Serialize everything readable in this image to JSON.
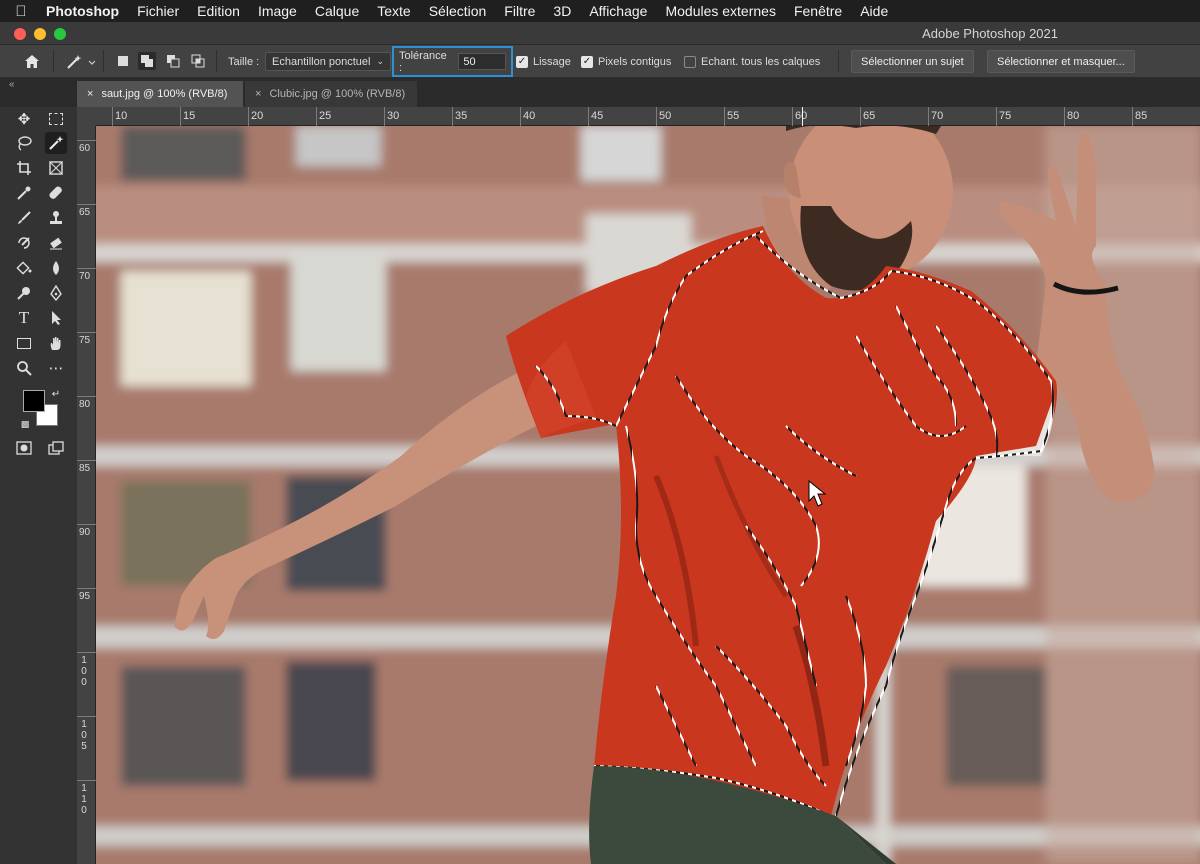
{
  "menubar": {
    "app_name": "Photoshop",
    "items": [
      "Fichier",
      "Edition",
      "Image",
      "Calque",
      "Texte",
      "Sélection",
      "Filtre",
      "3D",
      "Affichage",
      "Modules externes",
      "Fenêtre",
      "Aide"
    ]
  },
  "window": {
    "title": "Adobe Photoshop 2021"
  },
  "options": {
    "size_label": "Taille :",
    "size_value": "Echantillon ponctuel",
    "tolerance_label": "Tolérance :",
    "tolerance_value": "50",
    "antialias_label": "Lissage",
    "contiguous_label": "Pixels contigus",
    "sample_all_label": "Echant. tous les calques",
    "select_subject_label": "Sélectionner un sujet",
    "select_mask_label": "Sélectionner et masquer..."
  },
  "tabs": [
    {
      "label": "saut.jpg @ 100% (RVB/8)",
      "active": true
    },
    {
      "label": "Clubic.jpg @ 100% (RVB/8)",
      "active": false
    }
  ],
  "ruler": {
    "h_labels": [
      "10",
      "15",
      "20",
      "25",
      "30",
      "35",
      "40",
      "45",
      "50",
      "55",
      "60",
      "65",
      "70",
      "75",
      "80",
      "85"
    ],
    "v_labels": [
      "60",
      "65",
      "70",
      "75",
      "80",
      "85",
      "90",
      "95",
      "100",
      "105",
      "110"
    ]
  },
  "colors": {
    "accent": "#2d8fd5",
    "shirt": "#c9371f",
    "ui_dark": "#333333"
  },
  "icons": {
    "tools": [
      "move",
      "marquee",
      "lasso",
      "magic-wand",
      "crop",
      "frame",
      "eyedropper",
      "healing",
      "brush",
      "stamp",
      "history-brush",
      "eraser",
      "gradient",
      "blur",
      "dodge",
      "pen",
      "type",
      "path-select",
      "rectangle",
      "hand",
      "zoom",
      "more"
    ]
  }
}
